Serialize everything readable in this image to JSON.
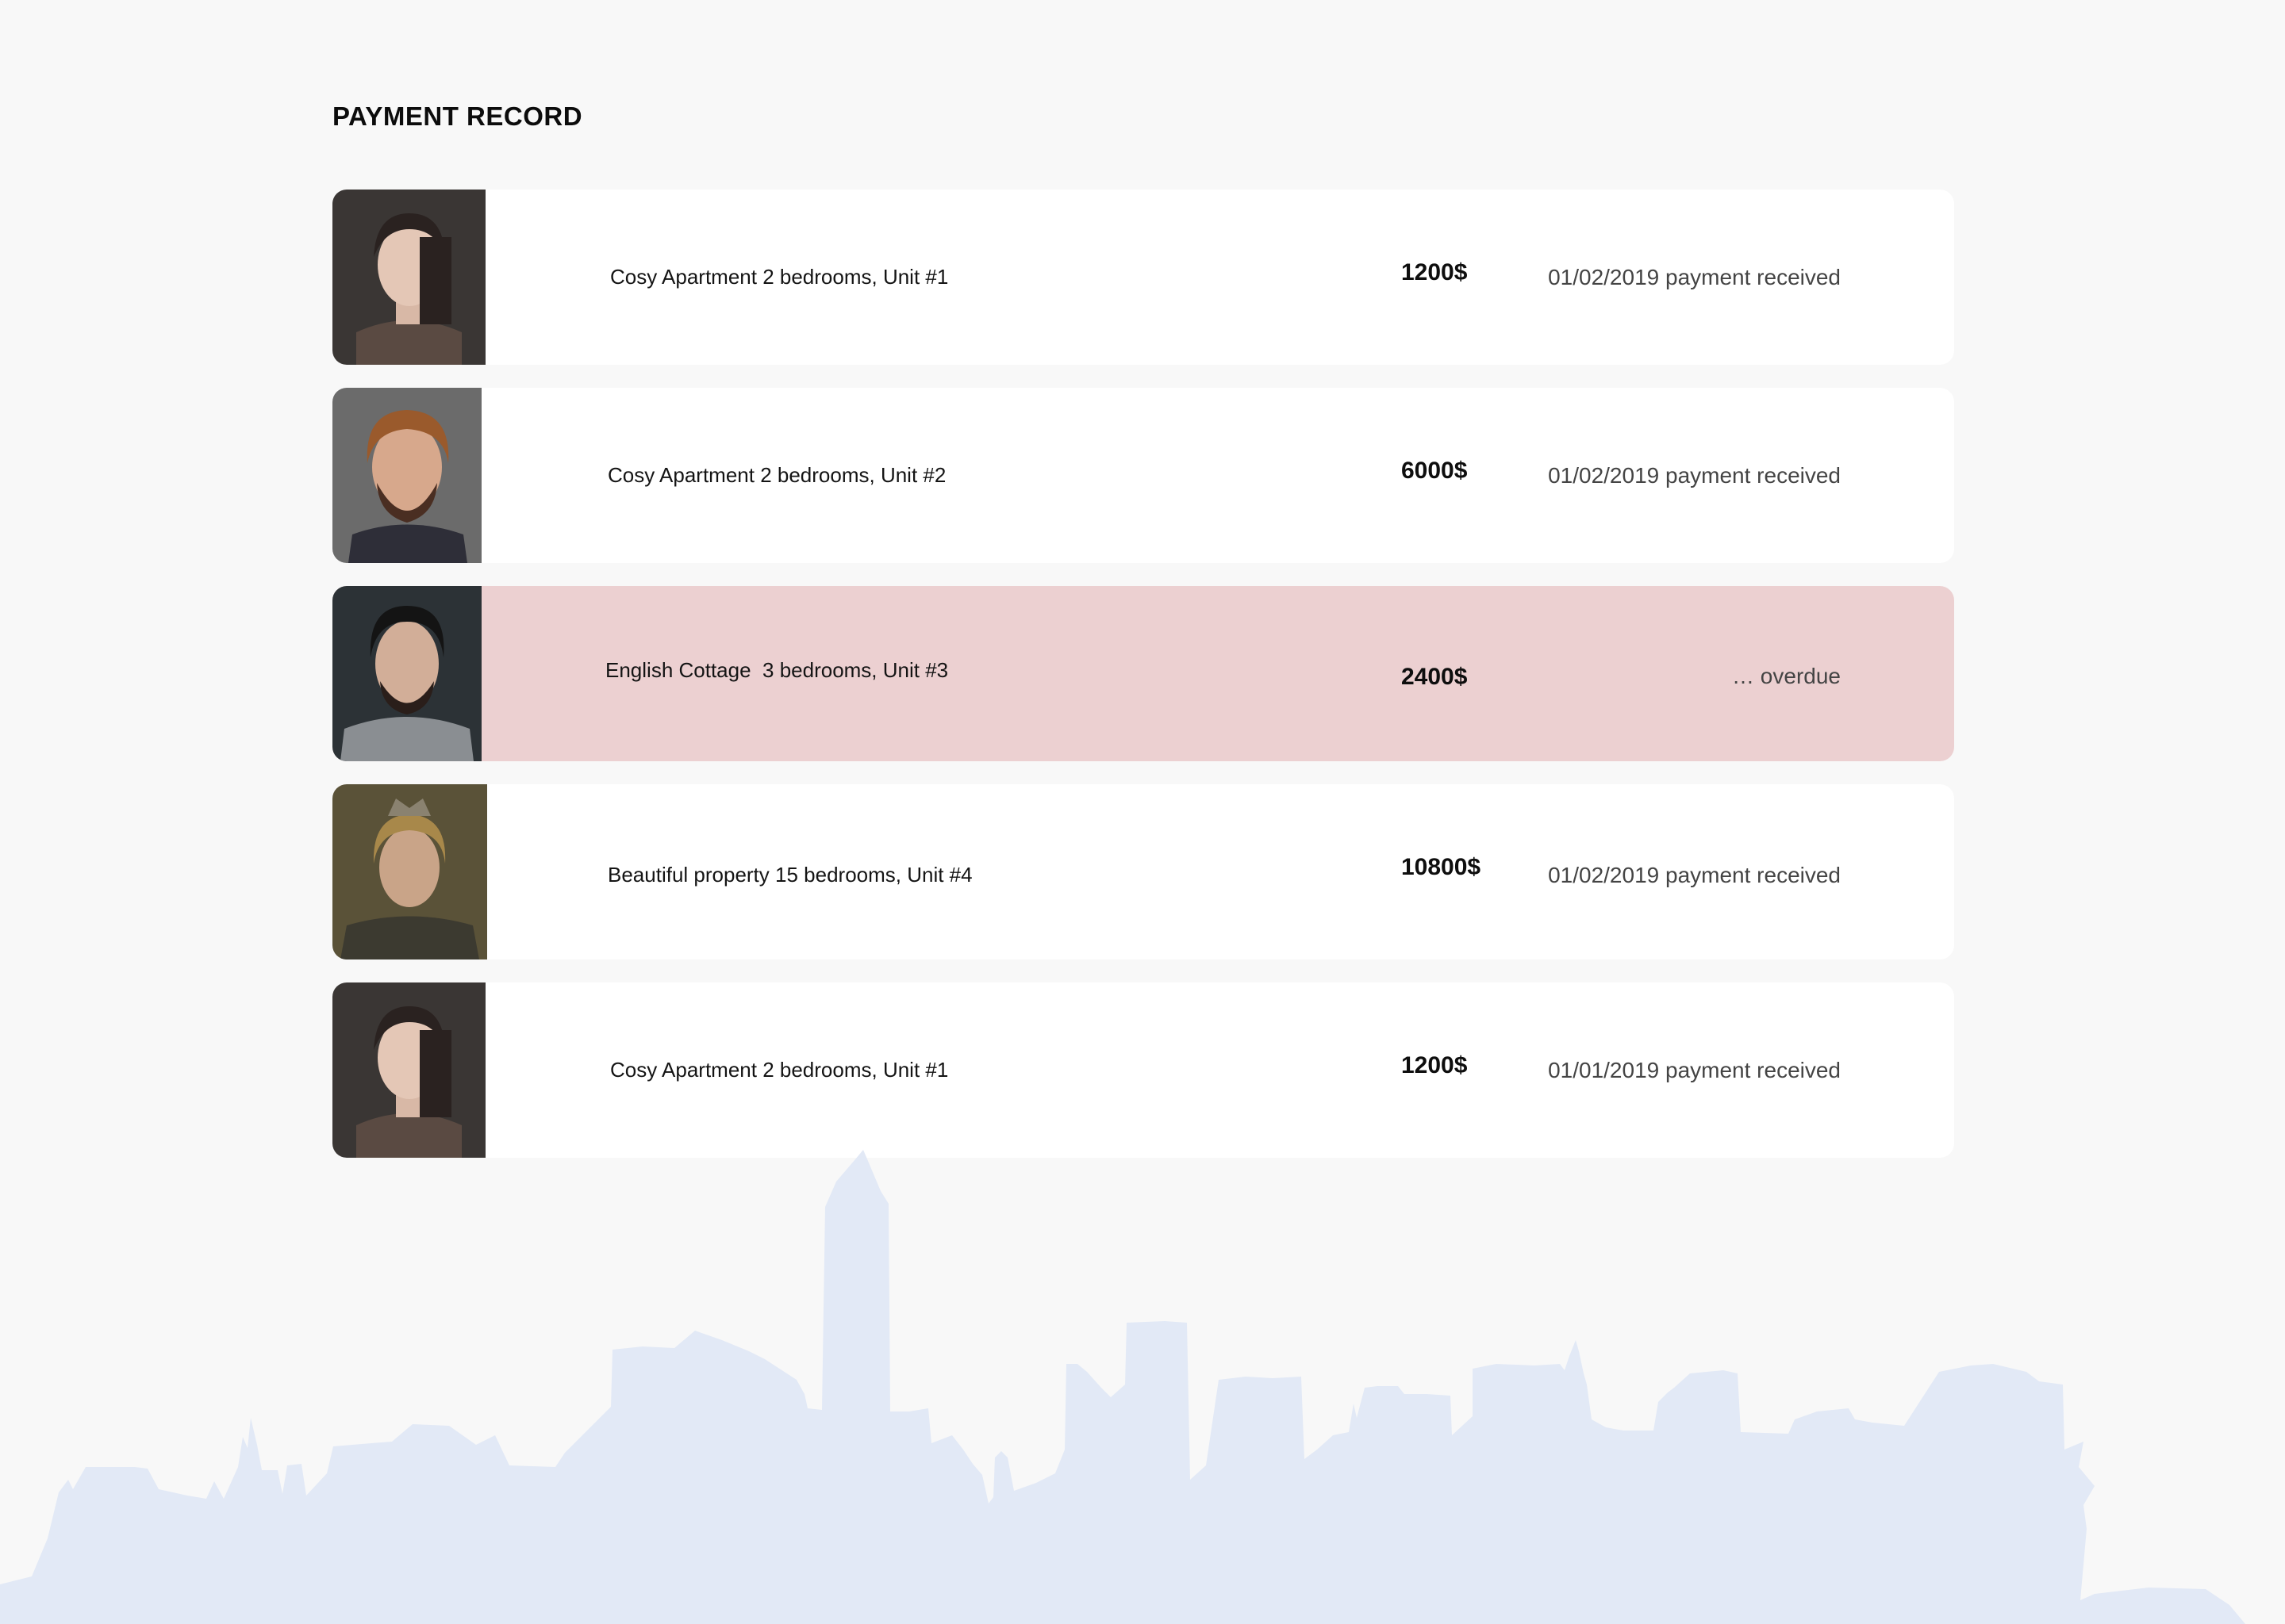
{
  "page": {
    "title": "PAYMENT RECORD"
  },
  "colors": {
    "background": "#f8f8f8",
    "row": "#ffffff",
    "overdue_row": "#ecd0d1",
    "skyline": "#e2e9f6"
  },
  "records": [
    {
      "avatar_icon": "tenant-portrait-icon",
      "property": "Cosy Apartment 2 bedrooms, Unit #1",
      "amount": "1200$",
      "status": "01/02/2019 payment received",
      "overdue": false
    },
    {
      "avatar_icon": "tenant-portrait-icon",
      "property": "Cosy Apartment 2 bedrooms, Unit #2",
      "amount": "6000$",
      "status": "01/02/2019 payment received",
      "overdue": false
    },
    {
      "avatar_icon": "tenant-portrait-icon",
      "property": "English Cottage  3 bedrooms, Unit #3",
      "amount": "2400$",
      "status": "… overdue",
      "overdue": true
    },
    {
      "avatar_icon": "tenant-portrait-icon",
      "property": "Beautiful property 15 bedrooms, Unit #4",
      "amount": "10800$",
      "status": "01/02/2019 payment received",
      "overdue": false
    },
    {
      "avatar_icon": "tenant-portrait-icon",
      "property": "Cosy Apartment 2 bedrooms, Unit #1",
      "amount": "1200$",
      "status": "01/01/2019 payment received",
      "overdue": false
    }
  ]
}
